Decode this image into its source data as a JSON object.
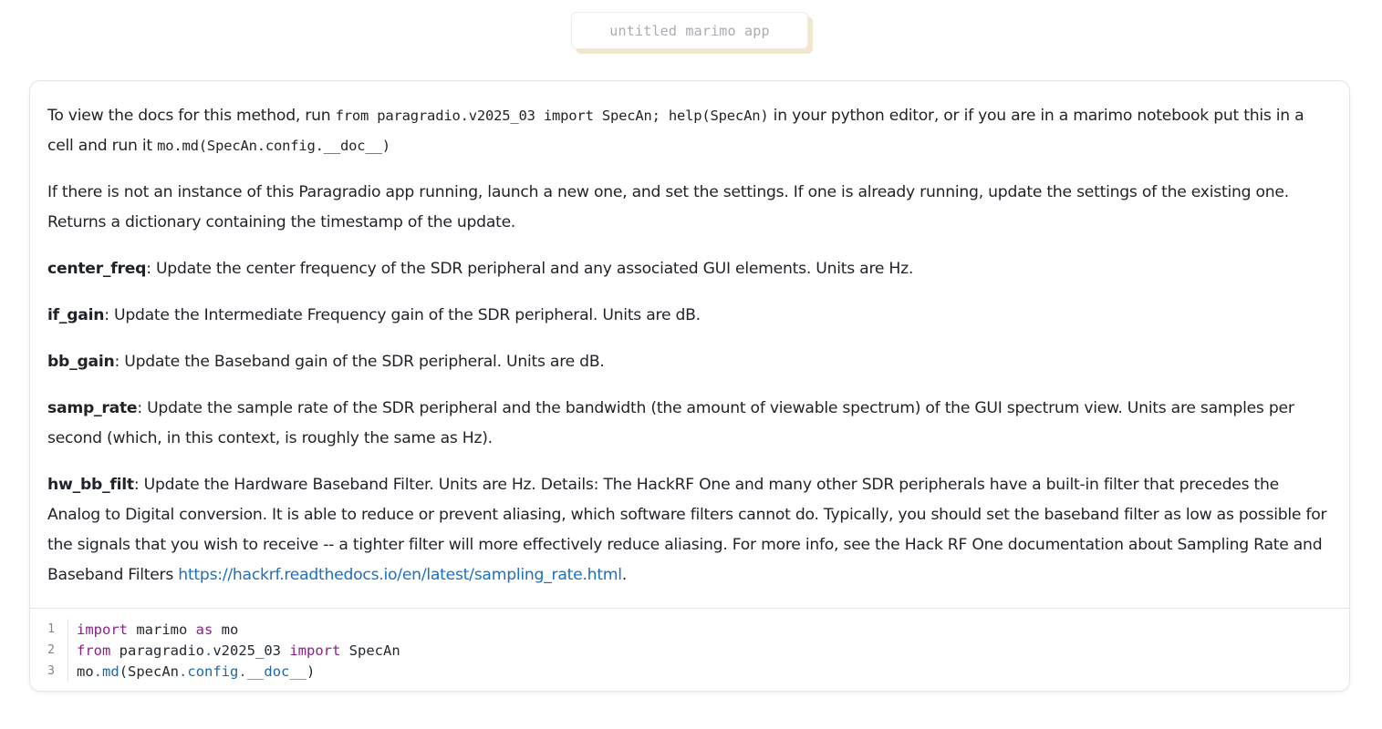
{
  "app": {
    "title": "untitled marimo app"
  },
  "doc": {
    "intro_prefix": "To view the docs for this method, run ",
    "intro_code1": "from paragradio.v2025_03 import SpecAn; help(SpecAn)",
    "intro_middle": " in your python editor, or if you are in a marimo notebook put this in a cell and run it ",
    "intro_code2": "mo.md(SpecAn.config.__doc__)",
    "description": "If there is not an instance of this Paragradio app running, launch a new one, and set the settings. If one is already running, update the settings of the existing one. Returns a dictionary containing the timestamp of the update.",
    "params": [
      {
        "name": "center_freq",
        "text": ": Update the center frequency of the SDR peripheral and any associated GUI elements. Units are Hz."
      },
      {
        "name": "if_gain",
        "text": ": Update the Intermediate Frequency gain of the SDR peripheral. Units are dB."
      },
      {
        "name": "bb_gain",
        "text": ": Update the Baseband gain of the SDR peripheral. Units are dB."
      },
      {
        "name": "samp_rate",
        "text": ": Update the sample rate of the SDR peripheral and the bandwidth (the amount of viewable spectrum) of the GUI spectrum view. Units are samples per second (which, in this context, is roughly the same as Hz)."
      },
      {
        "name": "hw_bb_filt",
        "text": ": Update the Hardware Baseband Filter. Units are Hz. Details: The HackRF One and many other SDR peripherals have a built-in filter that precedes the Analog to Digital conversion. It is able to reduce or prevent aliasing, which software filters cannot do. Typically, you should set the baseband filter as low as possible for the signals that you wish to receive -- a tighter filter will more effectively reduce aliasing. For more info, see the Hack RF One documentation about Sampling Rate and Baseband Filters "
      }
    ],
    "link_text": "https://hackrf.readthedocs.io/en/latest/sampling_rate.html",
    "link_suffix": "."
  },
  "code": {
    "line_numbers": [
      "1",
      "2",
      "3"
    ],
    "line1": {
      "kw1": "import",
      "t1": " marimo ",
      "kw2": "as",
      "t2": " mo"
    },
    "line2": {
      "kw1": "from",
      "t1": " paragradio",
      "dot": ".",
      "t2": "v2025_03 ",
      "kw2": "import",
      "t3": " SpecAn"
    },
    "line3": {
      "t1": "mo",
      "dot1": ".",
      "a1": "md",
      "t2": "(SpecAn",
      "dot2": ".",
      "a2": "config",
      "dot3": ".",
      "a3": "__doc__",
      "t3": ")"
    }
  },
  "colors": {
    "keyword": "#8a1f8a",
    "attribute": "#2266aa",
    "link": "#1d6fc0"
  }
}
